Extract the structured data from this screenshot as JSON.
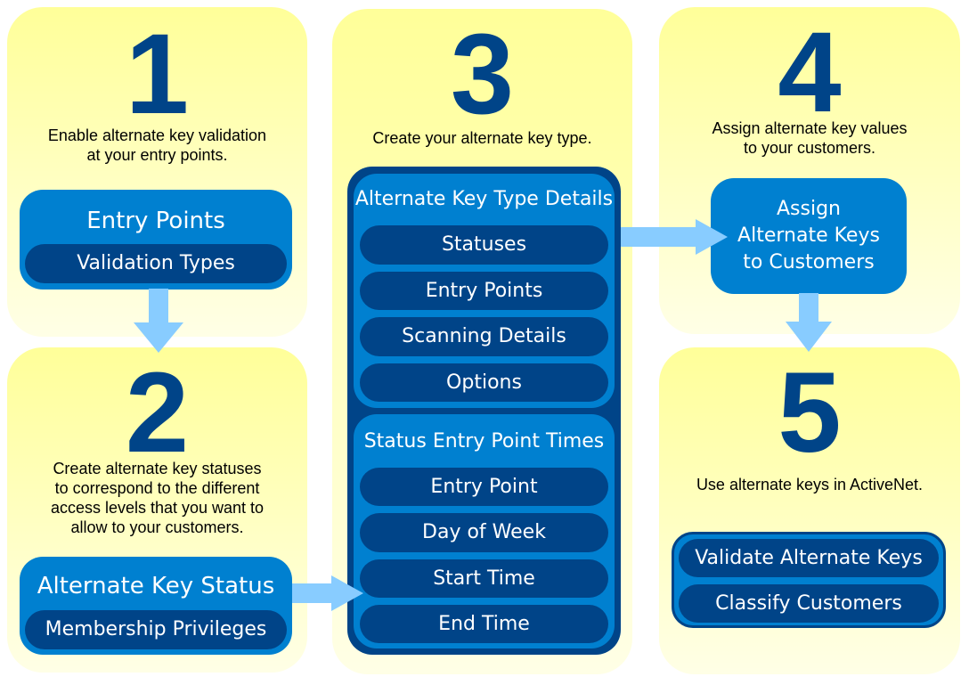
{
  "colors": {
    "panel": "#ffff99",
    "box": "#0080d0",
    "pill": "#004488",
    "arrow": "#88ccff",
    "number": "#004488"
  },
  "step1": {
    "number": "1",
    "description": [
      "Enable alternate key validation",
      "at your entry points."
    ],
    "box_title": "Entry Points",
    "items": [
      "Validation Types"
    ]
  },
  "step2": {
    "number": "2",
    "description": [
      "Create alternate key statuses",
      "to correspond to the different",
      "access levels that you want to",
      "allow to your customers."
    ],
    "box_title": "Alternate Key Status",
    "items": [
      "Membership Privileges"
    ]
  },
  "step3": {
    "number": "3",
    "description": [
      "Create your alternate key type."
    ],
    "section1": {
      "title": "Alternate Key Type Details",
      "items": [
        "Statuses",
        "Entry Points",
        "Scanning Details",
        "Options"
      ]
    },
    "section2": {
      "title": "Status Entry Point Times",
      "items": [
        "Entry Point",
        "Day of Week",
        "Start Time",
        "End Time"
      ]
    }
  },
  "step4": {
    "number": "4",
    "description": [
      "Assign alternate key values",
      "to your customers."
    ],
    "box_lines": [
      "Assign",
      "Alternate Keys",
      "to Customers"
    ]
  },
  "step5": {
    "number": "5",
    "description": [
      "Use alternate keys in ActiveNet."
    ],
    "items": [
      "Validate Alternate Keys",
      "Classify Customers"
    ]
  }
}
